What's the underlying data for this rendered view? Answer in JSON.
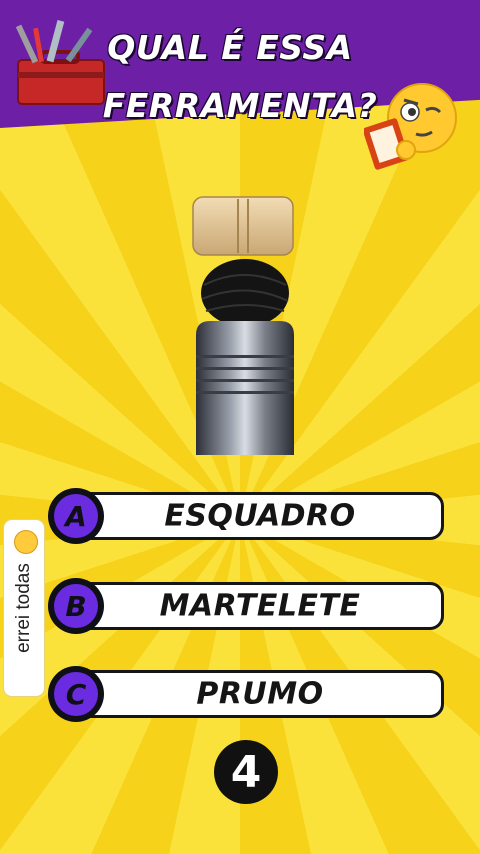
{
  "title": {
    "line1": "QUAL É ESSA",
    "line2": "FERRAMENTA?"
  },
  "icons": {
    "toolbox": "toolbox-icon",
    "emoji": "thinking-clipboard-emoji"
  },
  "image": {
    "subject": "prumo-tool-image"
  },
  "answers": [
    {
      "letter": "A",
      "text": "ESQUADRO"
    },
    {
      "letter": "B",
      "text": "MARTELETE"
    },
    {
      "letter": "C",
      "text": "PRUMO"
    }
  ],
  "side_label": {
    "text": "errei todas"
  },
  "timer": {
    "value": "4"
  },
  "colors": {
    "header": "#6d1fa6",
    "background": "#f6d21b",
    "badge": "#6b2be0"
  }
}
